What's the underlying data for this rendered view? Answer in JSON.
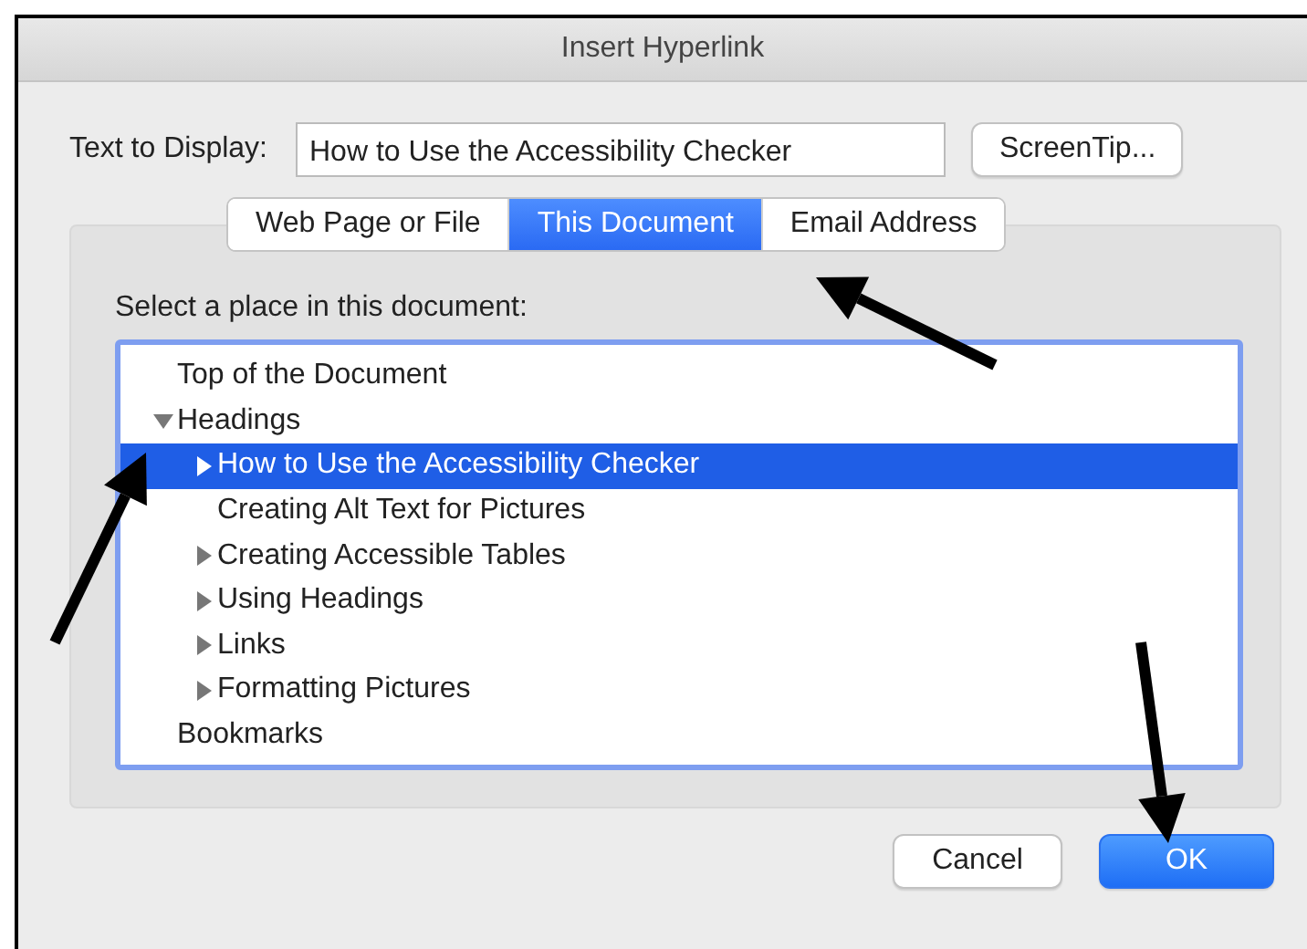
{
  "window": {
    "title": "Insert Hyperlink"
  },
  "text_to_display": {
    "label": "Text to Display:",
    "value": "How to Use the Accessibility Checker"
  },
  "screentip_button": "ScreenTip...",
  "tabs": [
    {
      "label": "Web Page or File",
      "selected": false
    },
    {
      "label": "This Document",
      "selected": true
    },
    {
      "label": "Email Address",
      "selected": false
    }
  ],
  "place_label": "Select a place in this document:",
  "tree": [
    {
      "label": "Top of the Document",
      "expandable": false,
      "selected": false
    },
    {
      "label": "Headings",
      "expandable": true,
      "expanded": true,
      "selected": false,
      "children": [
        {
          "label": "How to Use the Accessibility Checker",
          "expandable": true,
          "expanded": false,
          "selected": true
        },
        {
          "label": "Creating Alt Text for Pictures",
          "expandable": false,
          "selected": false
        },
        {
          "label": "Creating Accessible Tables",
          "expandable": true,
          "expanded": false,
          "selected": false
        },
        {
          "label": "Using Headings",
          "expandable": true,
          "expanded": false,
          "selected": false
        },
        {
          "label": "Links",
          "expandable": true,
          "expanded": false,
          "selected": false
        },
        {
          "label": "Formatting Pictures",
          "expandable": true,
          "expanded": false,
          "selected": false
        }
      ]
    },
    {
      "label": "Bookmarks",
      "expandable": false,
      "selected": false
    }
  ],
  "buttons": [
    {
      "label": "Cancel",
      "kind": "secondary"
    },
    {
      "label": "OK",
      "kind": "primary"
    }
  ]
}
